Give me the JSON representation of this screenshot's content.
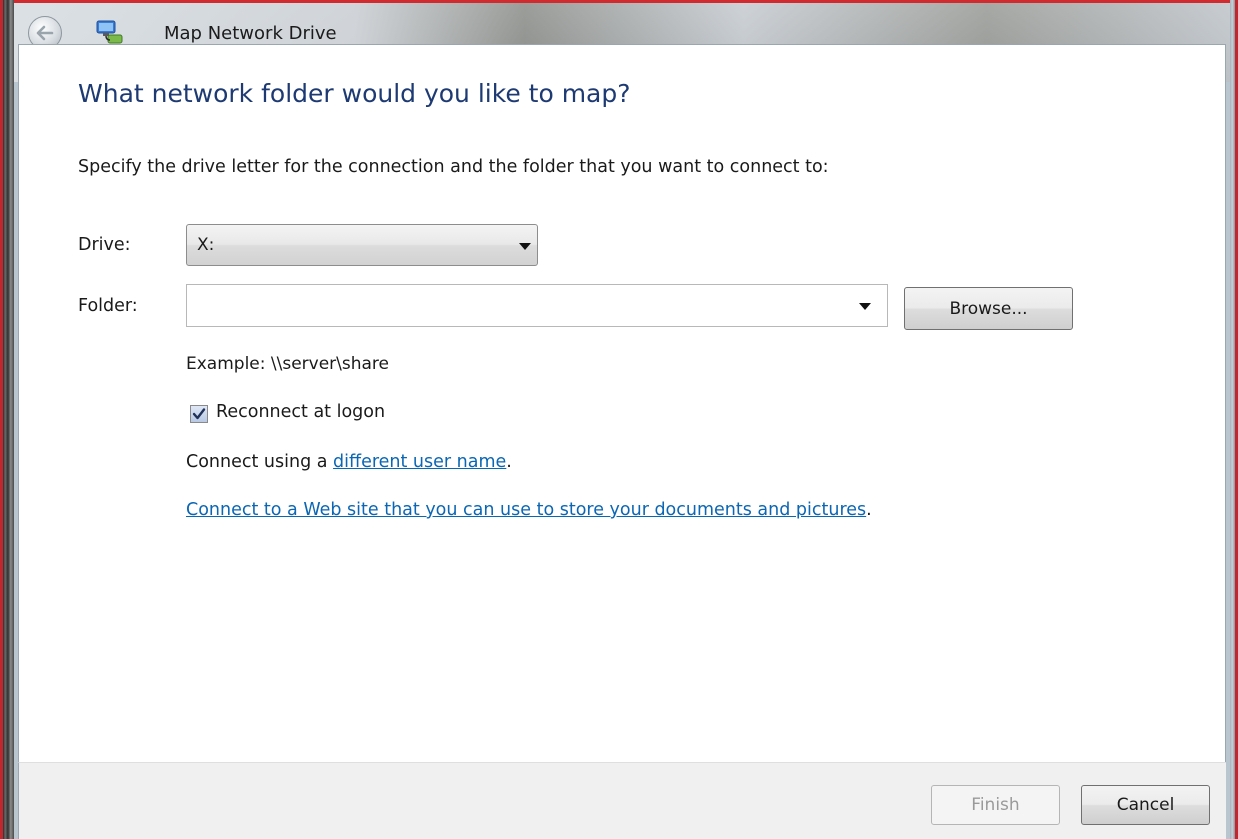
{
  "window": {
    "title": "Map Network Drive",
    "back_icon": "back-arrow-icon",
    "app_icon": "network-drive-icon"
  },
  "main": {
    "heading": "What network folder would you like to map?",
    "instruction": "Specify the drive letter for the connection and the folder that you want to connect to:",
    "drive_label": "Drive:",
    "drive_value": "X:",
    "folder_label": "Folder:",
    "folder_value": "",
    "browse_label": "Browse...",
    "example_text": "Example: \\\\server\\share",
    "reconnect": {
      "label": "Reconnect at logon",
      "checked": true
    },
    "connect_using_prefix": "Connect using a ",
    "connect_using_link": "different user name",
    "connect_using_suffix": ".",
    "web_site_link": "Connect to a Web site that you can use to store your documents and pictures",
    "web_site_suffix": "."
  },
  "footer": {
    "finish_label": "Finish",
    "cancel_label": "Cancel"
  },
  "colors": {
    "heading": "#1e3a73",
    "link": "#0b66b4",
    "frame_accent": "#c1272d"
  }
}
